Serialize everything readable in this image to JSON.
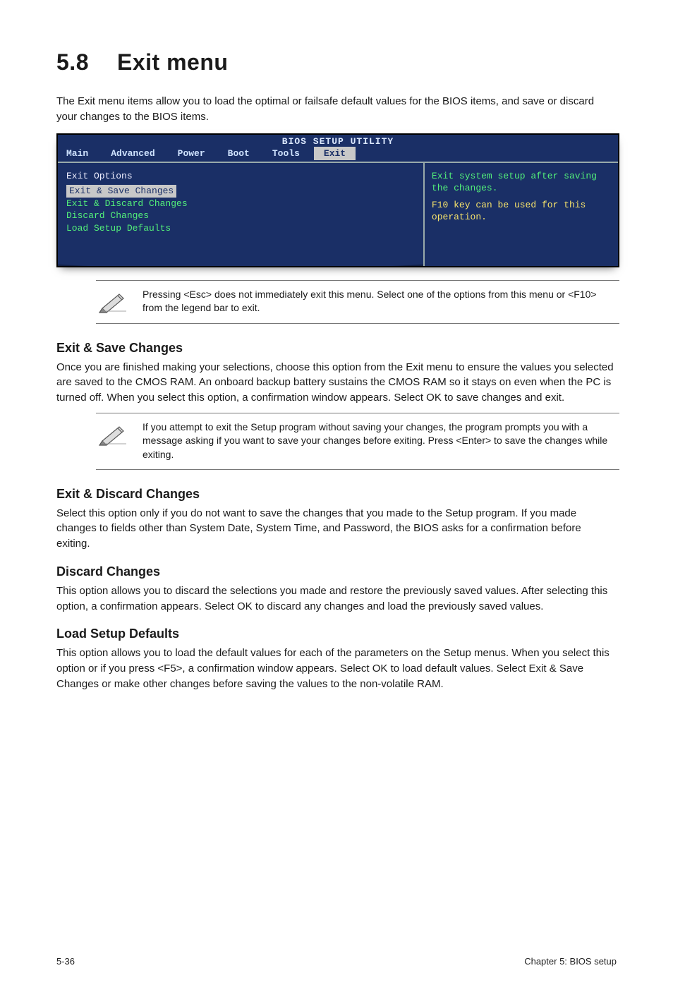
{
  "title_number": "5.8",
  "title_text": "Exit menu",
  "intro": "The Exit menu items allow you to load the optimal or failsafe default values for the BIOS items, and save or discard your changes to the BIOS items.",
  "bios": {
    "header": "BIOS SETUP UTILITY",
    "tabs": [
      "Main",
      "Advanced",
      "Power",
      "Boot",
      "Tools",
      "Exit"
    ],
    "active_tab_index": 5,
    "left": {
      "heading": "Exit Options",
      "items": [
        {
          "label": "Exit & Save Changes",
          "selected": true
        },
        {
          "label": "Exit & Discard Changes",
          "selected": false
        },
        {
          "label": "Discard Changes",
          "selected": false
        },
        {
          "label": "",
          "selected": false
        },
        {
          "label": "Load Setup Defaults",
          "selected": false
        }
      ]
    },
    "right": {
      "line1": "Exit system setup after saving the changes.",
      "line2": "F10 key can be used for this operation."
    }
  },
  "note1": "Pressing <Esc> does not immediately exit this menu. Select one of the options from this menu or <F10> from the legend bar to exit.",
  "sections": {
    "s1": {
      "heading": "Exit & Save Changes",
      "body": "Once you are finished making your selections, choose this option from the Exit menu to ensure the values you selected are saved to the CMOS RAM. An onboard backup battery sustains the CMOS RAM so it stays on even when the PC is turned off. When you select this option, a confirmation window appears. Select OK to save changes and exit."
    },
    "note2": " If you attempt to exit the Setup program without saving your changes, the program prompts you with a message asking if you want to save your changes before exiting. Press <Enter>  to save the  changes while exiting.",
    "s2": {
      "heading": "Exit & Discard Changes",
      "body": "Select this option only if you do not want to save the changes that you  made to the Setup program. If you made changes to fields other than System Date, System Time, and Password, the BIOS asks for a confirmation before exiting."
    },
    "s3": {
      "heading": "Discard Changes",
      "body": "This option allows you to discard the selections you made and restore the previously saved values. After selecting this option, a confirmation appears. Select OK to discard any changes and load the previously saved values."
    },
    "s4": {
      "heading": "Load Setup Defaults",
      "body": "This option allows you to load the default values for each of the parameters on the Setup menus. When you select this option or if you press <F5>, a confirmation window appears. Select OK to load default values. Select Exit & Save Changes or make other changes before saving the values to the non-volatile RAM."
    }
  },
  "footer": {
    "left": "5-36",
    "right": "Chapter 5: BIOS setup"
  }
}
